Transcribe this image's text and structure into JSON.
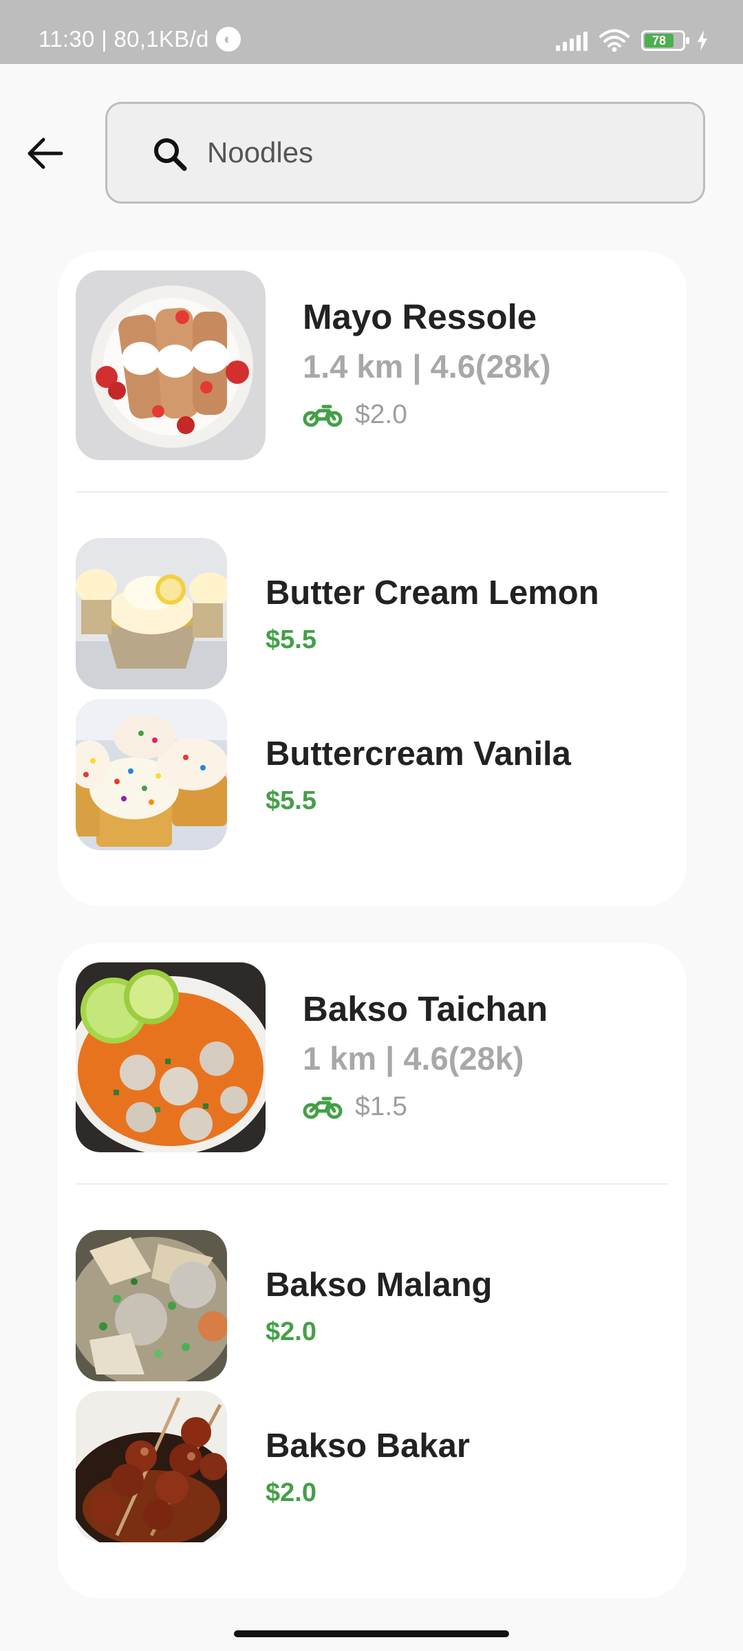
{
  "status": {
    "time_speed": "11:30 | 80,1KB/d",
    "battery": "78"
  },
  "search": {
    "value": "Noodles"
  },
  "restaurants": [
    {
      "name": "Mayo Ressole",
      "meta": "1.4 km | 4.6(28k)",
      "delivery_fee": "$2.0",
      "items": [
        {
          "name": "Butter Cream Lemon",
          "price": "$5.5"
        },
        {
          "name": "Buttercream Vanila",
          "price": "$5.5"
        }
      ]
    },
    {
      "name": "Bakso Taichan",
      "meta": "1 km | 4.6(28k)",
      "delivery_fee": "$1.5",
      "items": [
        {
          "name": "Bakso Malang",
          "price": "$2.0"
        },
        {
          "name": "Bakso Bakar",
          "price": "$2.0"
        }
      ]
    }
  ],
  "colors": {
    "accent_green": "#43a047",
    "status_bar": "#bdbdbd"
  }
}
